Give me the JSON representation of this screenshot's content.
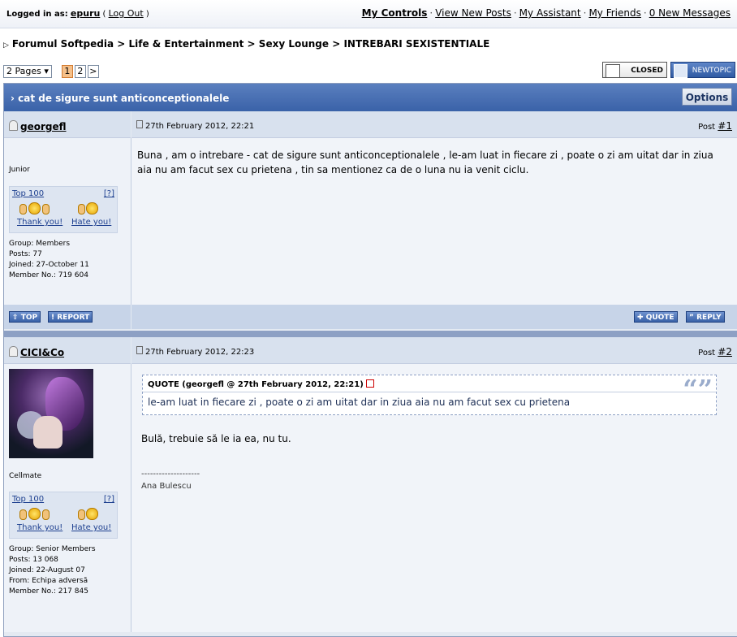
{
  "topbar": {
    "logged_in_label": "Logged in as:",
    "username": "epuru",
    "logout": "Log Out",
    "nav": [
      "My Controls",
      "View New Posts",
      "My Assistant",
      "My Friends",
      "0 New Messages"
    ]
  },
  "breadcrumb": [
    "Forumul Softpedia",
    "Life & Entertainment",
    "Sexy Lounge",
    "INTREBARI SEXISTENTIALE"
  ],
  "pagination": {
    "select_label": "2 Pages",
    "pages": [
      "1",
      "2"
    ],
    "current": "1",
    "next": ">"
  },
  "buttons": {
    "closed": "CLOSED",
    "new_topic": "NEWTOPIC",
    "options": "Options",
    "top": "TOP",
    "report": "REPORT",
    "quote": "QUOTE",
    "reply": "REPLY"
  },
  "thread_title": "cat de sigure sunt anticonceptionalele",
  "posts": [
    {
      "author": "georgefl",
      "date": "27th February 2012, 22:21",
      "post_label": "Post",
      "post_number": "#1",
      "rank": "Junior",
      "top100": "Top 100",
      "help": "[?]",
      "thank": "Thank you!",
      "hate": "Hate you!",
      "info": [
        "Group: Members",
        "Posts: 77",
        "Joined: 27-October 11",
        "Member No.: 719 604"
      ],
      "body": "Buna , am o intrebare - cat de sigure sunt anticonceptionalele , le-am luat in fiecare zi , poate o zi am uitat dar in ziua aia nu am facut sex cu prietena , tin sa mentionez ca de o luna nu ia venit ciclu."
    },
    {
      "author": "CICI&Co",
      "date": "27th February 2012, 22:23",
      "post_label": "Post",
      "post_number": "#2",
      "rank": "Cellmate",
      "top100": "Top 100",
      "help": "[?]",
      "thank": "Thank you!",
      "hate": "Hate you!",
      "info": [
        "Group: Senior Members",
        "Posts: 13 068",
        "Joined: 22-August 07",
        "From: Echipa adversă",
        "Member No.: 217 845"
      ],
      "quote_header": "QUOTE (georgefl @ 27th February 2012, 22:21)",
      "quote_body": "le-am luat in fiecare zi , poate o zi am uitat dar in ziua aia nu am facut sex cu prietena",
      "quote_mark": "“”",
      "body": "Bulă, trebuie să le ia ea, nu tu.",
      "sig_line": "--------------------",
      "signature": "Ana Bulescu"
    }
  ],
  "colors": {
    "header_blue": "#3a62a8",
    "panel_bg": "#e4eaf2",
    "accent_orange": "#f5c08a"
  }
}
